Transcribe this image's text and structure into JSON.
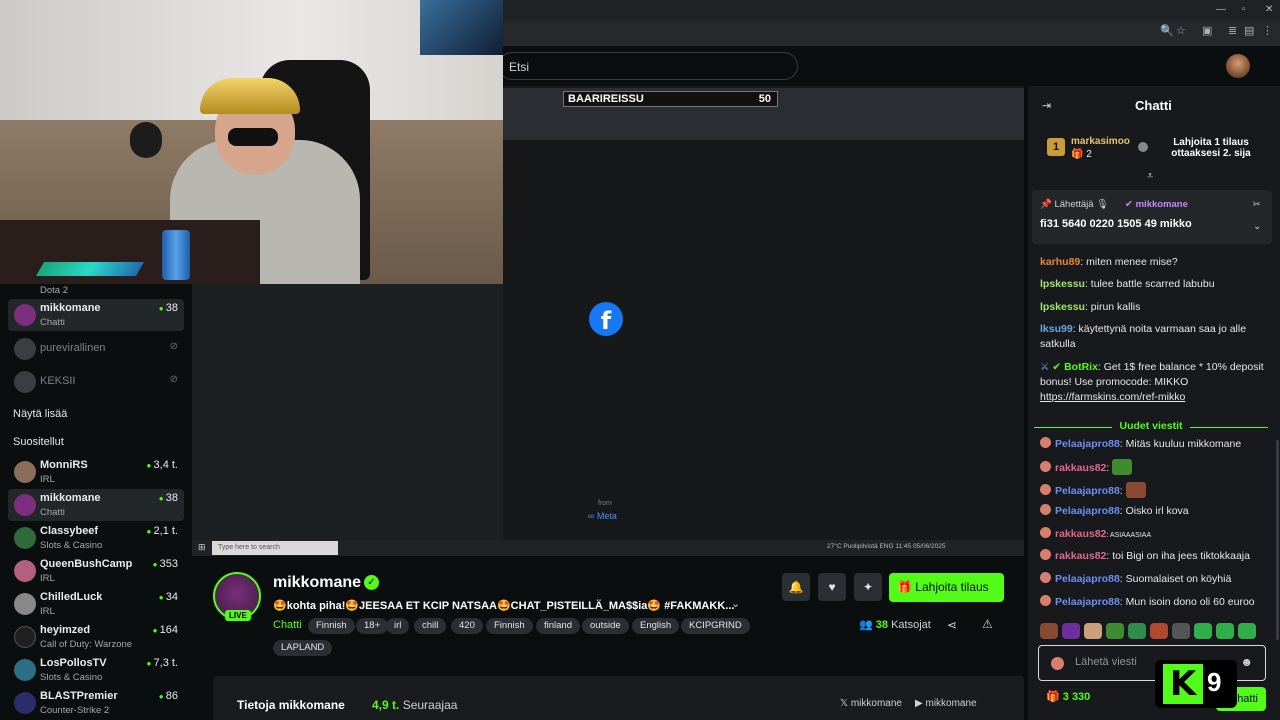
{
  "search": {
    "placeholder": "Etsi"
  },
  "player": {
    "overlay_title": "BAARIREISSU",
    "overlay_value": "50",
    "from_label": "from",
    "meta_label": "∞ Meta",
    "taskbar_search": "Type here to search",
    "taskbar_tray": "27°C  Puolipilvistä   ENG   11:45 05/06/2025"
  },
  "sidebar": {
    "top_sub": "Dota 2",
    "following": [
      {
        "name": "mikkomane",
        "sub": "Chatti",
        "count": "38",
        "active": true
      },
      {
        "name": "purevirallinen",
        "offline": true
      },
      {
        "name": "KEKSII",
        "offline": true
      }
    ],
    "show_more": "Näytä lisää",
    "recommended_title": "Suositellut",
    "recommended": [
      {
        "name": "MonniRS",
        "sub": "IRL",
        "count": "3,4 t.",
        "color": "#8a6d5b"
      },
      {
        "name": "mikkomane",
        "sub": "Chatti",
        "count": "38",
        "color": "#7b2f7e"
      },
      {
        "name": "Classybeef",
        "sub": "Slots & Casino",
        "count": "2,1 t.",
        "color": "#2f6b3a"
      },
      {
        "name": "QueenBushCamp",
        "sub": "IRL",
        "count": "353",
        "color": "#b2607e"
      },
      {
        "name": "ChilledLuck",
        "sub": "IRL",
        "count": "34",
        "color": "#888888"
      },
      {
        "name": "heyimzed",
        "sub": "Call of Duty: Warzone",
        "count": "164",
        "color": "#202020"
      },
      {
        "name": "LosPollosTV",
        "sub": "Slots & Casino",
        "count": "7,3 t.",
        "color": "#2a6f86"
      },
      {
        "name": "BLASTPremier",
        "sub": "Counter-Strike 2",
        "count": "86",
        "color": "#2b2d6b"
      }
    ]
  },
  "stream": {
    "name": "mikkomane",
    "live": "LIVE",
    "title": "🤩kohta piha!🤩JEESAA ET KCIP NATSAA🤩CHAT_PISTEILLÄ_MA$$ia🤩 #FAKMAKK...",
    "category": "Chatti",
    "tags": [
      "Finnish",
      "18+",
      "irl",
      "chill",
      "420",
      "Finnish",
      "finland",
      "outside",
      "English",
      "KCIPGRIND",
      "LAPLAND"
    ],
    "gift_label": "Lahjoita tilaus",
    "viewers_count": "38",
    "viewers_label": "Katsojat",
    "about_title": "Tietoja mikkomane",
    "followers_count": "4,9 t.",
    "followers_label": "Seuraajaa",
    "social_x": "mikkomane",
    "social_yt": "mikkomane"
  },
  "chat": {
    "title": "Chatti",
    "leader": {
      "rank": "1",
      "name": "markasimoo",
      "count": "2",
      "cta": "Lahjoita 1 tilaus ottaaksesi 2. sija"
    },
    "pinned": {
      "label": "Lähettäjä",
      "user": "mikkomane",
      "text": "fi31 5640 0220 1505 49 mikko"
    },
    "messages": [
      {
        "user": "karhu89",
        "text": ": miten menee mise?",
        "color": "#e58a36"
      },
      {
        "user": "lpskessu",
        "text": ": tulee battle scarred labubu",
        "color": "#a2e36a"
      },
      {
        "user": "lpskessu",
        "text": ": pirun kallis",
        "color": "#a2e36a"
      },
      {
        "user": "lksu99",
        "text": ": käytettynä noita varmaan saa jo alle satkulla",
        "color": "#6aa7e3"
      },
      {
        "user": "BotRix",
        "text": ": Get 1$ free balance * 10% deposit bonus! Use promocode: MIKKO",
        "link": "https://farmskins.com/ref-mikko",
        "color": "#53fc18"
      }
    ],
    "new_messages_label": "Uudet viestit",
    "new_messages": [
      {
        "user": "Pelaajapro88",
        "text": ": Mitäs kuuluu mikkomane",
        "color": "#6f8ff0"
      },
      {
        "user": "rakkaus82",
        "text": ":",
        "emote": "#3e8c2f",
        "color": "#e06a88"
      },
      {
        "user": "Pelaajapro88",
        "text": ":",
        "emote": "#8a4a32",
        "color": "#6f8ff0"
      },
      {
        "user": "Pelaajapro88",
        "text": ": Oisko irl kova",
        "color": "#6f8ff0"
      },
      {
        "user": "rakkaus82",
        "text": ": ASIAAASIAA",
        "color": "#e06a88"
      },
      {
        "user": "rakkaus82",
        "text": ": toi Bigi on iha jees tiktokkaaja",
        "color": "#e06a88"
      },
      {
        "user": "Pelaajapro88",
        "text": ": Suomalaiset on köyhiä",
        "color": "#6f8ff0"
      },
      {
        "user": "Pelaajapro88",
        "text": ": Mun isoin dono oli 60 euroo",
        "color": "#6f8ff0"
      }
    ],
    "input_placeholder": "Lähetä viesti",
    "points": "3 330",
    "send_label": "Chatti",
    "kick_logo_k": "K",
    "kick_logo_num": "9"
  }
}
